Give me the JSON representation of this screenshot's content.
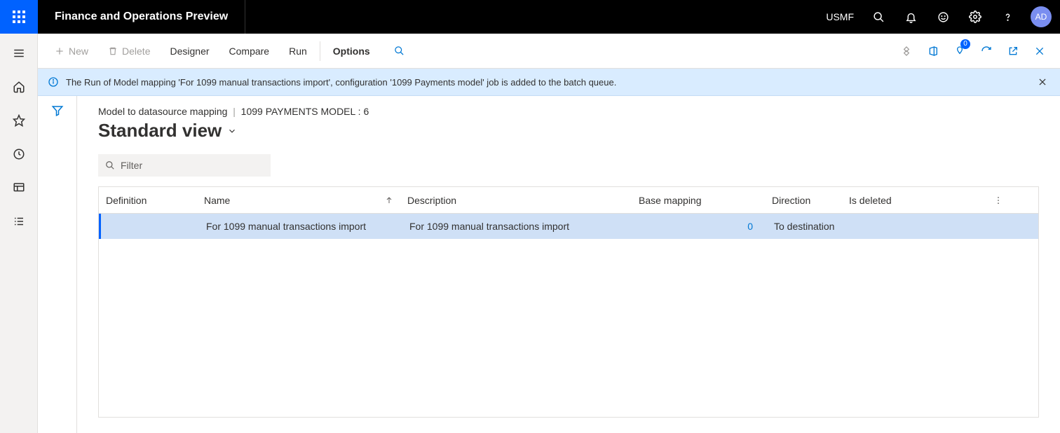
{
  "header": {
    "app_title": "Finance and Operations Preview",
    "company": "USMF",
    "avatar": "AD"
  },
  "actionbar": {
    "new": "New",
    "delete": "Delete",
    "designer": "Designer",
    "compare": "Compare",
    "run": "Run",
    "options": "Options",
    "badge_count": "0"
  },
  "banner": {
    "message": "The Run of Model mapping 'For 1099 manual transactions import', configuration '1099 Payments model' job is added to the batch queue."
  },
  "breadcrumb": {
    "page": "Model to datasource mapping",
    "context": "1099 PAYMENTS MODEL : 6"
  },
  "view": {
    "title": "Standard view"
  },
  "filter": {
    "placeholder": "Filter"
  },
  "columns": {
    "definition": "Definition",
    "name": "Name",
    "description": "Description",
    "base_mapping": "Base mapping",
    "direction": "Direction",
    "is_deleted": "Is deleted"
  },
  "rows": [
    {
      "definition": "",
      "name": "For 1099 manual transactions import",
      "description": "For 1099 manual transactions import",
      "base_mapping": "0",
      "direction": "To destination",
      "is_deleted": ""
    }
  ]
}
